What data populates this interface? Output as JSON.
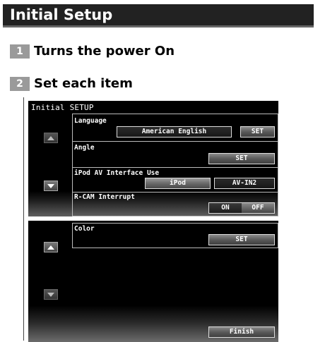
{
  "page": {
    "title": "Initial Setup",
    "steps": [
      {
        "num": "1",
        "text": "Turns the power On"
      },
      {
        "num": "2",
        "text": "Set each item"
      }
    ]
  },
  "screen1": {
    "title": "Initial SETUP",
    "language": {
      "label": "Language",
      "value": "American English",
      "set": "SET"
    },
    "angle": {
      "label": "Angle",
      "set": "SET"
    },
    "ipod": {
      "label": "iPod AV Interface Use",
      "opt1": "iPod",
      "opt2": "AV-IN2"
    },
    "rcam": {
      "label": "R-CAM Interrupt",
      "on": "ON",
      "off": "OFF"
    }
  },
  "screen2": {
    "color": {
      "label": "Color",
      "set": "SET"
    },
    "finish": "Finish"
  },
  "icons": [
    "up-arrow-icon",
    "down-arrow-icon"
  ]
}
